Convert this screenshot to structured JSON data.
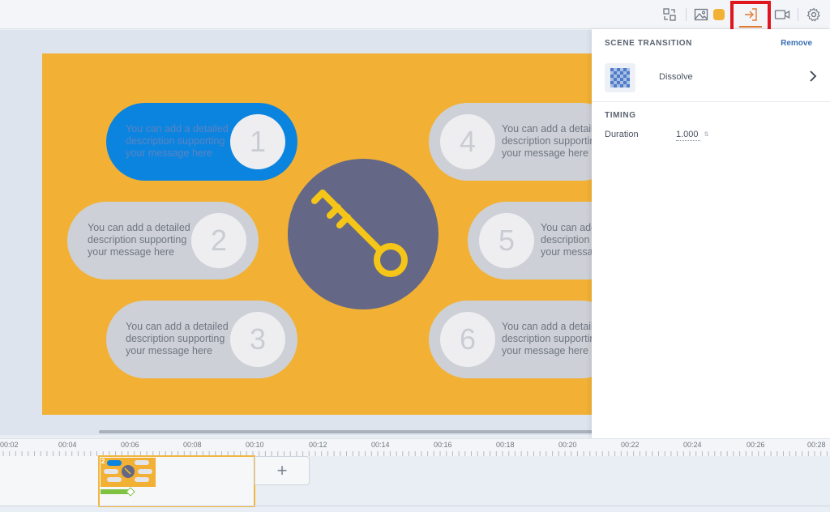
{
  "toolbar": {
    "icons": [
      "layout-swap-icon",
      "image-icon",
      "color-swatch",
      "transition-icon",
      "video-camera-icon",
      "settings-gear-icon"
    ],
    "accent_color": "#f2b134",
    "active_color": "#e47b2f",
    "highlight_color": "#e0161f"
  },
  "slide": {
    "background": "#f2b134",
    "items": [
      {
        "number": "1",
        "text": "You can add a detailed description supporting your message here",
        "active": true
      },
      {
        "number": "2",
        "text": "You can add a detailed description supporting your message here",
        "active": false
      },
      {
        "number": "3",
        "text": "You can add a detailed description supporting your message here",
        "active": false
      },
      {
        "number": "4",
        "text": "You can add a detailed description supporting your message here",
        "active": false
      },
      {
        "number": "5",
        "text": "You can add a detailed description supporting your message here",
        "active": false
      },
      {
        "number": "6",
        "text": "You can add a detailed description supporting your message here",
        "active": false
      }
    ],
    "center_icon": "key-icon"
  },
  "panel": {
    "title": "SCENE TRANSITION",
    "remove_label": "Remove",
    "transition_name": "Dissolve",
    "timing_title": "TIMING",
    "duration_label": "Duration",
    "duration_value": "1.000",
    "duration_unit": "s"
  },
  "timeline": {
    "ruler_labels": [
      "00:02",
      "00:04",
      "00:06",
      "00:08",
      "00:10",
      "00:12",
      "00:14",
      "00:16",
      "00:18",
      "00:20",
      "00:22",
      "00:24",
      "00:26",
      "00:28"
    ],
    "clip_number": "2",
    "add_label": "+"
  }
}
